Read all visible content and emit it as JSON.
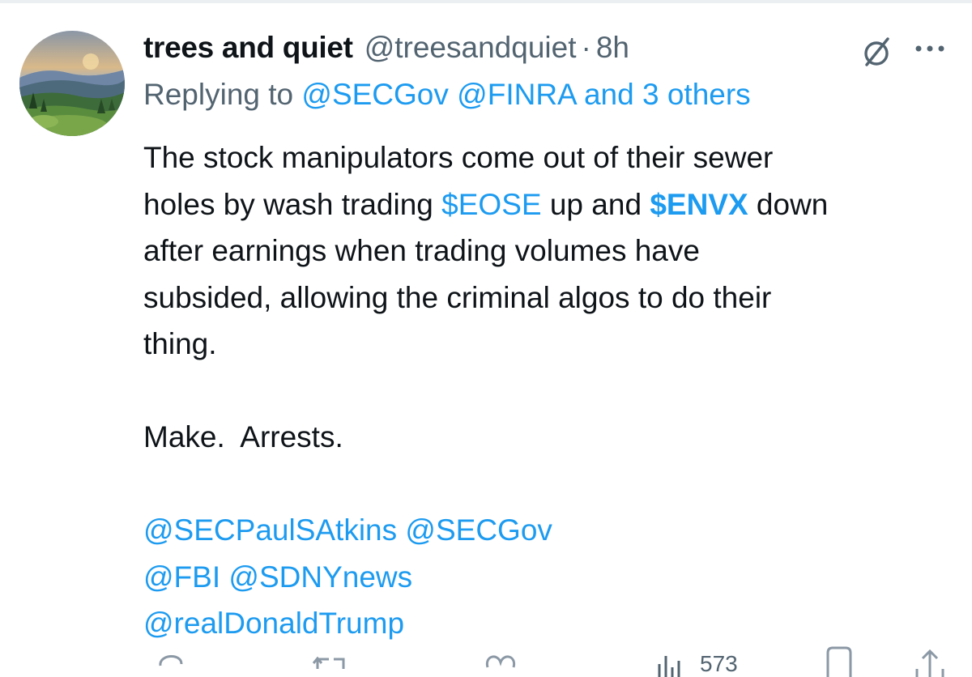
{
  "tweet": {
    "display_name": "trees and quiet",
    "handle": "@treesandquiet",
    "separator": "·",
    "time": "8h",
    "replying_prefix": "Replying to ",
    "replying_targets": "@SECGov @FINRA and 3 others",
    "body": {
      "line1": "The stock manipulators come out of their sewer",
      "line2_a": "holes by wash trading ",
      "cashtag1": "$EOSE",
      "line2_b": " up and ",
      "cashtag2": "$ENVX",
      "line2_c": " down",
      "line3": "after earnings when trading volumes have",
      "line4": "subsided, allowing the criminal algos to do their",
      "line5": "thing.",
      "line6": "Make.  Arrests.",
      "mentions_line1": "@SECPaulSAtkins @SECGov",
      "mentions_line2": "@FBI @SDNYnews",
      "mentions_line3": "@realDonaldTrump"
    }
  },
  "actions": {
    "views": "573",
    "icons": [
      "reply-icon",
      "retweet-icon",
      "like-icon",
      "views-icon",
      "bookmark-icon",
      "share-icon"
    ]
  },
  "colors": {
    "accent": "#1d9bf0",
    "text": "#0f1419",
    "secondary": "#536471"
  }
}
